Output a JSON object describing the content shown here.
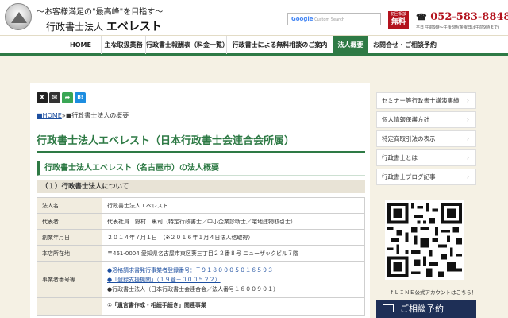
{
  "header": {
    "tagline": "～お客様満足の\"最高峰\"を目指す～",
    "site_name_prefix": "行政書士法人",
    "site_name_main": "エベレスト",
    "search_placeholder": "Custom Search",
    "search_brand": "Google",
    "free_badge_small": "初回相談",
    "free_badge_big": "無料",
    "phone_icon": "☎",
    "phone": "052-583-8848",
    "hours": "平日 午前9時〜午後8時(金曜日は午前9時まで)"
  },
  "nav": {
    "items": [
      {
        "label": "HOME"
      },
      {
        "label": "主な取扱業務"
      },
      {
        "label": "行政書士報酬表（料金一覧）"
      },
      {
        "label": "行政書士による無料相談のご案内"
      },
      {
        "label": "法人概要"
      },
      {
        "label": "お問合せ・ご相談予約"
      }
    ],
    "active_index": 4
  },
  "share": {
    "buttons": [
      {
        "icon": "x-icon",
        "glyph": "X",
        "color": "#222222"
      },
      {
        "icon": "mail-icon",
        "glyph": "✉",
        "color": "#333333"
      },
      {
        "icon": "share-icon",
        "glyph": "➦",
        "color": "#3aa655"
      },
      {
        "icon": "hatena-icon",
        "glyph": "B!",
        "color": "#1d8de0"
      }
    ]
  },
  "breadcrumb": {
    "home": "■HOME",
    "sep": "»",
    "current": "■行政書士法人の概要"
  },
  "main": {
    "page_title": "行政書士法人エベレスト（日本行政書士会連合会所属）",
    "section_title": "行政書士法人エベレスト（名古屋市）の法人概要",
    "sub_title": "（１）行政書士法人について",
    "table": [
      {
        "key": "法人名",
        "value": "行政書士法人エベレスト"
      },
      {
        "key": "代表者",
        "value": "代表社員　野村　篤司（特定行政書士／中小企業診断士／宅地建物取引士）"
      },
      {
        "key": "創業年月日",
        "value": "２０１４年７月１日　（※２０１６年１月４日法人格取得）"
      },
      {
        "key": "本店所在地",
        "value": "〒461-0004 愛知県名古屋市東区葵三丁目２２番８号 ニューザックビル７階"
      }
    ],
    "business_numbers": {
      "key": "事業者番号等",
      "line1": "●適格請求書発行事業者登録番号：Ｔ９１８０００５０１６５９３",
      "line2": "●「登録支援機関」（１９登－０００５２２）",
      "line3": "●行政書士法人（日本行政書士会連合会／法人番号１６００９０１）"
    },
    "partial_row": "①「遺言書作成・相続手続き」関連事業"
  },
  "sidebar": {
    "items": [
      {
        "label": "セミナー等行政書士講演実績"
      },
      {
        "label": "個人情報保護方針"
      },
      {
        "label": "特定商取引法の表示"
      },
      {
        "label": "行政書士とは"
      },
      {
        "label": "行政書士ブログ記事"
      }
    ],
    "chevron": "›",
    "line_caption": "↑ＬＩＮＥ公式アカウントはこちら！",
    "consult_label": "ご相談予約"
  },
  "colors": {
    "brand_green": "#2e7a45",
    "accent_red": "#b3121d",
    "navy": "#1e2f56",
    "background": "#f5f1e4"
  }
}
